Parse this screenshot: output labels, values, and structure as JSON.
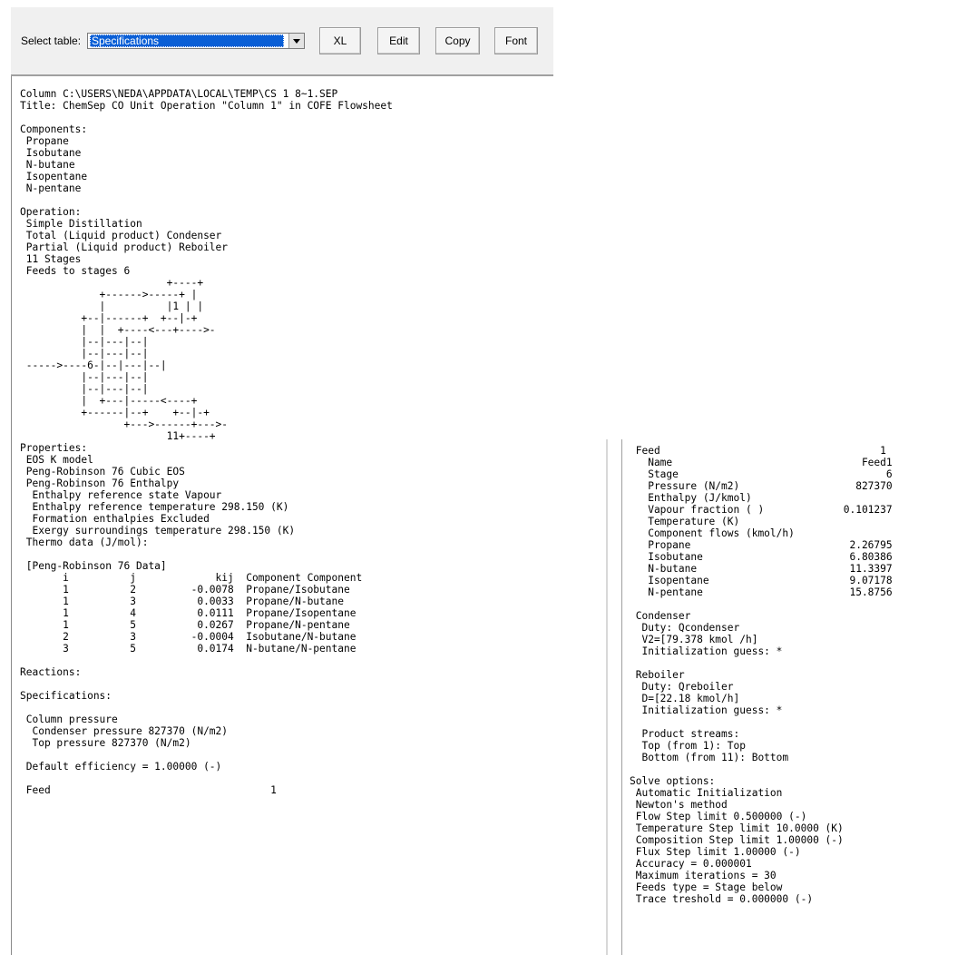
{
  "toolbar": {
    "select_label": "Select table:",
    "selected_table": "Specifications",
    "xl_label": "XL",
    "edit_label": "Edit",
    "copy_label": "Copy",
    "font_label": "Font"
  },
  "report_left": "Column C:\\USERS\\NEDA\\APPDATA\\LOCAL\\TEMP\\CS 1 8~1.SEP\nTitle: ChemSep CO Unit Operation \"Column 1\" in COFE Flowsheet\n\nComponents:\n Propane\n Isobutane\n N-butane\n Isopentane\n N-pentane\n\nOperation:\n Simple Distillation\n Total (Liquid product) Condenser\n Partial (Liquid product) Reboiler\n 11 Stages\n Feeds to stages 6\n                        +----+\n             +------>-----+ |\n             |          |1 | |\n          +--|------+  +--|-+\n          |  |  +----<---+---->-\n          |--|---|--|\n          |--|---|--|\n ----->----6-|--|---|--|\n          |--|---|--|\n          |--|---|--|\n          |  +---|-----<----+\n          +------|--+    +--|-+\n                 +--->------+--->-\n                        11+----+\nProperties:\n EOS K model\n Peng-Robinson 76 Cubic EOS\n Peng-Robinson 76 Enthalpy\n  Enthalpy reference state Vapour\n  Enthalpy reference temperature 298.150 (K)\n  Formation enthalpies Excluded\n  Exergy surroundings temperature 298.150 (K)\n Thermo data (J/mol):\n\n [Peng-Robinson 76 Data]\n       i          j             kij  Component Component\n       1          2         -0.0078  Propane/Isobutane\n       1          3          0.0033  Propane/N-butane\n       1          4          0.0111  Propane/Isopentane\n       1          5          0.0267  Propane/N-pentane\n       2          3         -0.0004  Isobutane/N-butane\n       3          5          0.0174  N-butane/N-pentane\n\nReactions:\n\nSpecifications:\n\n Column pressure\n  Condenser pressure 827370 (N/m2)\n  Top pressure 827370 (N/m2)\n\n Default efficiency = 1.00000 (-)\n\n Feed                                    1",
  "report_right": " Feed                                    1\n   Name                               Feed1\n   Stage                                  6\n   Pressure (N/m2)                   827370\n   Enthalpy (J/kmol)\n   Vapour fraction ( )             0.101237\n   Temperature (K)\n   Component flows (kmol/h)\n   Propane                          2.26795\n   Isobutane                        6.80386\n   N-butane                         11.3397\n   Isopentane                       9.07178\n   N-pentane                        15.8756\n\n Condenser\n  Duty: Qcondenser\n  V2=[79.378 kmol /h]\n  Initialization guess: *\n\n Reboiler\n  Duty: Qreboiler\n  D=[22.18 kmol/h]\n  Initialization guess: *\n\n  Product streams:\n  Top (from 1): Top\n  Bottom (from 11): Bottom\n\nSolve options:\n Automatic Initialization\n Newton's method\n Flow Step limit 0.500000 (-)\n Temperature Step limit 10.0000 (K)\n Composition Step limit 1.00000 (-)\n Flux Step limit 1.00000 (-)\n Accuracy = 0.000001\n Maximum iterations = 30\n Feeds type = Stage below\n Trace treshold = 0.000000 (-)"
}
